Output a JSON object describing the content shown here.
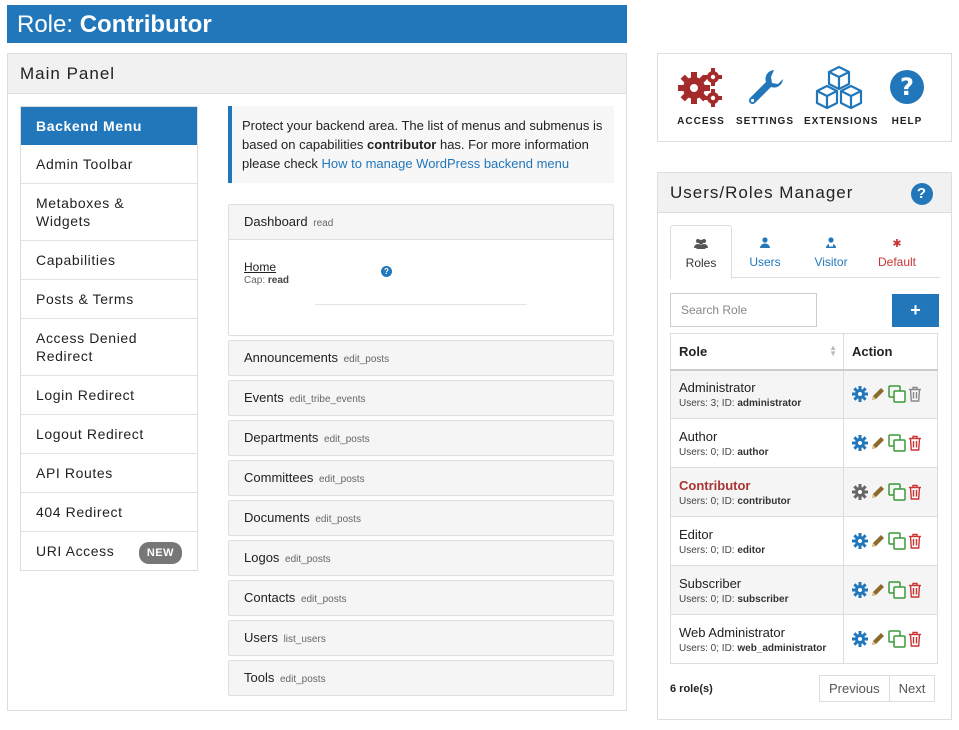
{
  "title": {
    "prefix": "Role:",
    "role": "Contributor"
  },
  "main_panel": {
    "heading": "Main Panel",
    "menu": [
      {
        "label": "Backend Menu",
        "active": true
      },
      {
        "label": "Admin Toolbar"
      },
      {
        "label": "Metaboxes & Widgets"
      },
      {
        "label": "Capabilities"
      },
      {
        "label": "Posts & Terms"
      },
      {
        "label": "Access Denied Redirect"
      },
      {
        "label": "Login Redirect"
      },
      {
        "label": "Logout Redirect"
      },
      {
        "label": "API Routes"
      },
      {
        "label": "404 Redirect"
      },
      {
        "label": "URI Access",
        "badge": "NEW"
      }
    ],
    "info": {
      "text_1": "Protect your backend area. The list of menus and submenus is based on capabilities ",
      "bold": "contributor",
      "text_2": " has. For more information please check ",
      "link": "How to manage WordPress backend menu"
    },
    "sections": [
      {
        "name": "Dashboard",
        "cap": "read",
        "expanded": true,
        "submenu": {
          "name": "Home",
          "cap_label": "Cap:",
          "cap": "read"
        }
      },
      {
        "name": "Announcements",
        "cap": "edit_posts"
      },
      {
        "name": "Events",
        "cap": "edit_tribe_events"
      },
      {
        "name": "Departments",
        "cap": "edit_posts"
      },
      {
        "name": "Committees",
        "cap": "edit_posts"
      },
      {
        "name": "Documents",
        "cap": "edit_posts"
      },
      {
        "name": "Logos",
        "cap": "edit_posts"
      },
      {
        "name": "Contacts",
        "cap": "edit_posts"
      },
      {
        "name": "Users",
        "cap": "list_users"
      },
      {
        "name": "Tools",
        "cap": "edit_posts"
      }
    ]
  },
  "toolbar": {
    "items": [
      {
        "label": "ACCESS",
        "icon": "gears-icon",
        "color": "#a52a2a"
      },
      {
        "label": "SETTINGS",
        "icon": "wrench-icon",
        "color": "#2277bb"
      },
      {
        "label": "EXTENSIONS",
        "icon": "cubes-icon",
        "color": "#2277bb"
      },
      {
        "label": "HELP",
        "icon": "question-circle-icon",
        "color": "#2277bb"
      }
    ]
  },
  "roles_manager": {
    "heading": "Users/Roles Manager",
    "tabs": [
      {
        "label": "Roles",
        "icon": "users-icon",
        "active": true
      },
      {
        "label": "Users",
        "icon": "user-icon"
      },
      {
        "label": "Visitor",
        "icon": "visitor-icon"
      },
      {
        "label": "Default",
        "icon": "asterisk-icon"
      }
    ],
    "search_placeholder": "Search Role",
    "add_label": "+",
    "columns": {
      "role": "Role",
      "action": "Action"
    },
    "rows": [
      {
        "name": "Administrator",
        "users_label": "Users: 3; ID:",
        "id": "administrator"
      },
      {
        "name": "Author",
        "users_label": "Users: 0; ID:",
        "id": "author"
      },
      {
        "name": "Contributor",
        "users_label": "Users: 0; ID:",
        "id": "contributor",
        "current": true
      },
      {
        "name": "Editor",
        "users_label": "Users: 0; ID:",
        "id": "editor"
      },
      {
        "name": "Subscriber",
        "users_label": "Users: 0; ID:",
        "id": "subscriber"
      },
      {
        "name": "Web Administrator",
        "users_label": "Users: 0; ID:",
        "id": "web_administrator"
      }
    ],
    "count_label": "6 role(s)",
    "pager": {
      "prev": "Previous",
      "next": "Next"
    }
  },
  "colors": {
    "accent": "#2277bb",
    "danger": "#cc3333",
    "success": "#3a9a3a",
    "brown": "#8b6a2b"
  }
}
